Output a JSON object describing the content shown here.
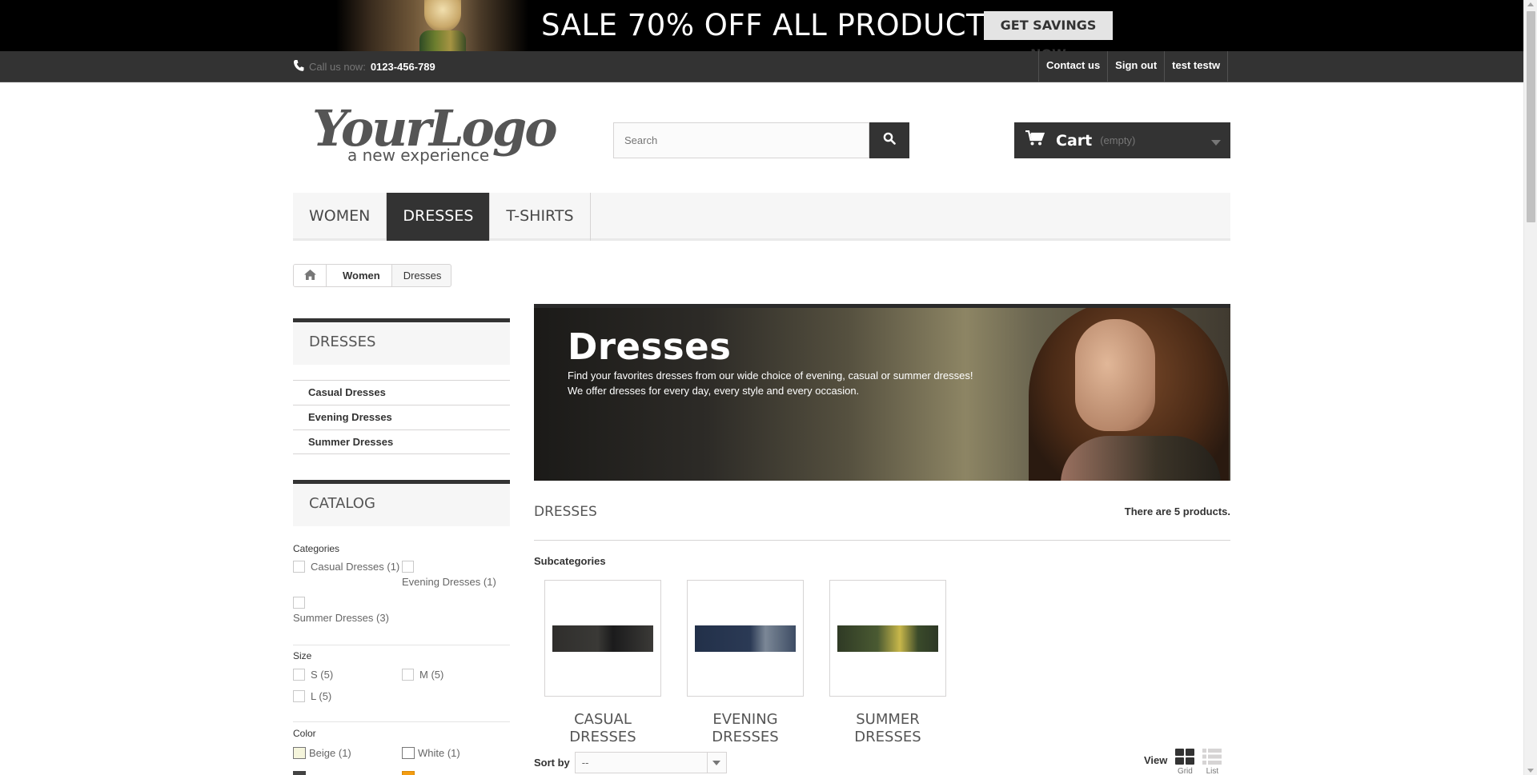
{
  "promo": {
    "headline": "SALE 70% OFF ALL PRODUCTS",
    "cta": "GET SAVINGS NOW"
  },
  "topbar": {
    "call_label": "Call us now:",
    "phone": "0123-456-789",
    "links": [
      "Contact us",
      "Sign out",
      "test testw"
    ]
  },
  "logo": {
    "text": "YourLogo",
    "tagline": "a new experience"
  },
  "search": {
    "placeholder": "Search"
  },
  "cart": {
    "label": "Cart",
    "status": "(empty)"
  },
  "menu": {
    "items": [
      "WOMEN",
      "DRESSES",
      "T-SHIRTS"
    ],
    "active": "DRESSES"
  },
  "breadcrumb": {
    "items": [
      "Women",
      "Dresses"
    ]
  },
  "sidebar": {
    "category_title": "DRESSES",
    "categories": [
      "Casual Dresses",
      "Evening Dresses",
      "Summer Dresses"
    ],
    "catalog_title": "CATALOG",
    "filters": {
      "categories_label": "Categories",
      "categories": [
        "Casual Dresses (1)",
        "Evening Dresses (1)",
        "Summer Dresses (3)"
      ],
      "size_label": "Size",
      "sizes": [
        "S (5)",
        "M (5)",
        "L (5)"
      ],
      "color_label": "Color",
      "colors": [
        {
          "label": "Beige (1)",
          "hex": "#f5f5dc"
        },
        {
          "label": "White (1)",
          "hex": "#ffffff"
        }
      ],
      "more_color_hexes": [
        "#434343",
        "#f39c11"
      ]
    }
  },
  "category": {
    "banner_title": "Dresses",
    "banner_desc_line1": "Find your favorites dresses from our wide choice of evening, casual or summer dresses!",
    "banner_desc_line2": "We offer dresses for every day, every style and every occasion.",
    "heading": "DRESSES",
    "count": "There are 5 products.",
    "subcategories_label": "Subcategories",
    "subcategories": [
      {
        "line1": "CASUAL",
        "line2": "DRESSES"
      },
      {
        "line1": "EVENING",
        "line2": "DRESSES"
      },
      {
        "line1": "SUMMER",
        "line2": "DRESSES"
      }
    ]
  },
  "toolbar": {
    "sort_label": "Sort by",
    "sort_value": "--",
    "view_label": "View",
    "view_grid": "Grid",
    "view_list": "List"
  },
  "colors": {
    "dark": "#333333",
    "menu_bg": "#f6f6f6",
    "border": "#d6d4d4"
  }
}
